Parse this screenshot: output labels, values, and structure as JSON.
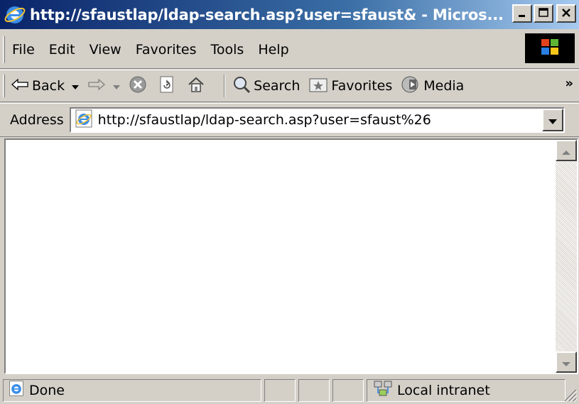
{
  "window": {
    "title": "http://sfaustlap/ldap-search.asp?user=sfaust& - Micros...",
    "minimize_label": "minimize",
    "maximize_label": "maximize",
    "close_label": "close"
  },
  "menu": {
    "items": [
      {
        "label": "File"
      },
      {
        "label": "Edit"
      },
      {
        "label": "View"
      },
      {
        "label": "Favorites"
      },
      {
        "label": "Tools"
      },
      {
        "label": "Help"
      }
    ]
  },
  "toolbar": {
    "back_label": "Back",
    "search_label": "Search",
    "favorites_label": "Favorites",
    "media_label": "Media",
    "more_label": "»"
  },
  "address": {
    "label": "Address",
    "url": "http://sfaustlap/ldap-search.asp?user=sfaust%26"
  },
  "status": {
    "text": "Done",
    "zone": "Local intranet"
  },
  "colors": {
    "chrome": "#d4d0c8",
    "titlebar_start": "#0a246a",
    "titlebar_end": "#a6caf0",
    "content_bg": "#ffffff"
  },
  "icons": {
    "title": "ie-logo-icon",
    "back": "back-arrow-icon",
    "forward": "forward-arrow-icon",
    "stop": "stop-icon",
    "refresh": "refresh-icon",
    "home": "home-icon",
    "search": "search-icon",
    "favorites": "favorites-icon",
    "media": "media-icon",
    "address": "ie-page-icon",
    "status": "ie-page-icon",
    "zone": "local-intranet-icon"
  }
}
